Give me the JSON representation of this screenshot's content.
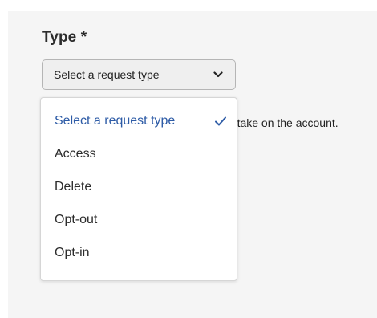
{
  "form": {
    "field_label": "Type *",
    "select": {
      "value": "Select a request type"
    },
    "helper_text": "to take on the account."
  },
  "dropdown": {
    "options": [
      {
        "label": "Select a request type",
        "selected": true
      },
      {
        "label": "Access",
        "selected": false
      },
      {
        "label": "Delete",
        "selected": false
      },
      {
        "label": "Opt-out",
        "selected": false
      },
      {
        "label": "Opt-in",
        "selected": false
      }
    ]
  },
  "colors": {
    "selected_text": "#2d5ba6",
    "panel_bg": "#f5f5f5"
  },
  "icons": {
    "chevron": "chevron-down-icon",
    "check": "checkmark-icon"
  }
}
